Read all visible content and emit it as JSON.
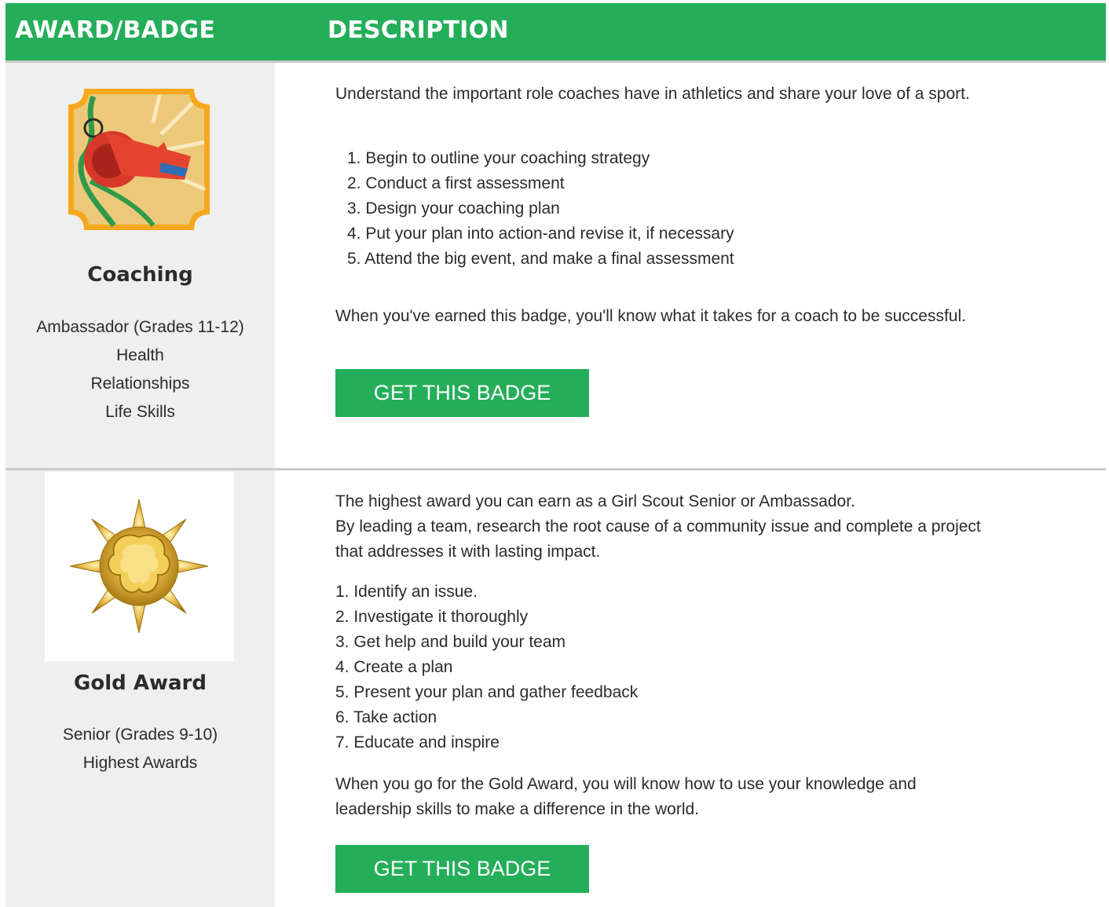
{
  "header": {
    "col_award": "AWARD/BADGE",
    "col_description": "DESCRIPTION"
  },
  "badges": [
    {
      "name": "Coaching",
      "icon": "coaching-whistle-badge",
      "meta": [
        "Ambassador (Grades 11-12)",
        "Health",
        "Relationships",
        "Life Skills"
      ],
      "intro": "Understand the important role coaches have in athletics and share your love of a sport.",
      "steps": [
        "1. Begin to outline your coaching strategy",
        "2. Conduct a first assessment",
        "3. Design your coaching plan",
        "4. Put your plan into action-and revise it, if necessary",
        "5. Attend the big event, and make a final assessment"
      ],
      "outro": "When you've earned this badge, you'll know what it takes for a coach to be successful.",
      "button": "GET THIS BADGE"
    },
    {
      "name": "Gold Award",
      "icon": "gold-award-pin",
      "meta": [
        "Senior (Grades 9-10)",
        "Highest Awards"
      ],
      "intro_lines": [
        "The highest award you can earn as a Girl Scout Senior or Ambassador.",
        "By leading a team, research the root cause of a community issue and complete a project",
        "that addresses it with lasting impact."
      ],
      "steps": [
        "1. Identify an issue.",
        "2. Investigate it thoroughly",
        "3. Get help and build your team",
        "4. Create a plan",
        "5. Present your plan and gather feedback",
        "6. Take action",
        "7. Educate and inspire"
      ],
      "outro_lines": [
        "When you go for the Gold Award, you will know how to use your knowledge and",
        "leadership skills to make a difference in the world."
      ],
      "button": "GET THIS BADGE"
    }
  ],
  "colors": {
    "accent": "#25ae5a",
    "left_bg": "#efefef",
    "divider": "#c9c9c9"
  }
}
